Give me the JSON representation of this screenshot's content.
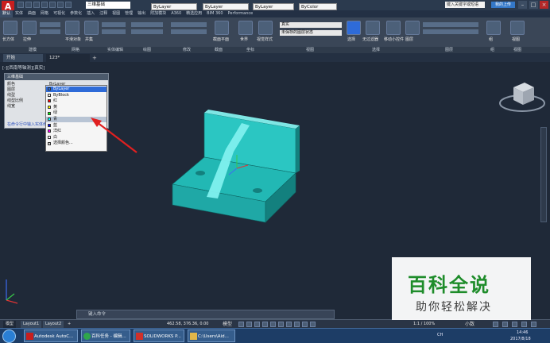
{
  "title_bar": {
    "app_logo": "A",
    "workspace": "三维基础",
    "color_combo": "ByLayer",
    "linetype_combo": "ByLayer",
    "lineweight_combo": "ByLayer",
    "plotstyle_combo": "ByColor",
    "search_placeholder": "键入关键字或短语",
    "signin": "我的上传",
    "window_controls": [
      "–",
      "□",
      "×"
    ]
  },
  "menu": {
    "items": [
      "默认",
      "实体",
      "曲面",
      "网格",
      "可视化",
      "参数化",
      "插入",
      "注释",
      "视图",
      "管理",
      "输出",
      "附加模块",
      "A360",
      "精选应用",
      "BIM 360",
      "Performance"
    ],
    "active_index": 0
  },
  "ribbon": {
    "buttons": [
      {
        "label": "长方体",
        "icon": "box-icon"
      },
      {
        "label": "拉伸",
        "icon": "extrude-icon"
      },
      {
        "label": "平滑对象",
        "icon": "smooth-icon"
      },
      {
        "label": "并集",
        "icon": "union-icon"
      },
      {
        "label": "视觉样式",
        "icon": "visual-style-icon"
      },
      {
        "label": "截面平面",
        "icon": "section-plane-icon"
      },
      {
        "label": "世界",
        "icon": "ucs-icon"
      },
      {
        "label": "图层",
        "icon": "layers-icon"
      },
      {
        "label": "选择",
        "icon": "cursor-icon"
      },
      {
        "label": "无过滤器",
        "icon": "filter-icon"
      },
      {
        "label": "移动小控件",
        "icon": "move-gizmo-icon"
      },
      {
        "label": "组",
        "icon": "group-icon"
      },
      {
        "label": "视图",
        "icon": "view-icon"
      }
    ],
    "visual_style_value": "真实",
    "layer_value": "未保存的图层状态",
    "panel_names": [
      "建模",
      "网格",
      "实体编辑",
      "绘图",
      "修改",
      "截面",
      "坐标",
      "视图",
      "选择",
      "图层",
      "组",
      "视图"
    ]
  },
  "doc_tabs": {
    "items": [
      "开始",
      "123*"
    ],
    "active_index": 1,
    "plus": "+"
  },
  "viewport_label": "[-][西南等轴测][真实]",
  "palette": {
    "title": "三维基础",
    "rows": [
      {
        "label": "颜色",
        "value": "ByLayer"
      },
      {
        "label": "图层",
        "value": ""
      },
      {
        "label": "线型",
        "value": ""
      },
      {
        "label": "线型比例",
        "value": ""
      },
      {
        "label": "线宽",
        "value": ""
      }
    ],
    "link": "在命令行中输入实体命令"
  },
  "color_dropdown": {
    "items": [
      {
        "label": "ByLayer",
        "swatch": "#ffffff"
      },
      {
        "label": "ByBlock",
        "swatch": "#ffffff"
      },
      {
        "label": "红",
        "swatch": "#ff0000"
      },
      {
        "label": "黄",
        "swatch": "#ffff00"
      },
      {
        "label": "绿",
        "swatch": "#00ff00"
      },
      {
        "label": "青",
        "swatch": "#00ffff"
      },
      {
        "label": "蓝",
        "swatch": "#0000ff"
      },
      {
        "label": "洋红",
        "swatch": "#ff00ff"
      },
      {
        "label": "白",
        "swatch": "#ffffff"
      },
      {
        "label": "选择颜色...",
        "swatch": "#cccccc"
      }
    ],
    "selected_index": 0,
    "highlight_index": 5
  },
  "model_colors": {
    "face_light": "#2bc6c2",
    "face_mid": "#1fa8a6",
    "face_dark": "#13807e",
    "strip": "#7ff0ee",
    "background": "#1f2938"
  },
  "command_line": {
    "placeholder": "键入命令"
  },
  "layout_tabs": {
    "items": [
      "模型",
      "Layout1",
      "Layout2"
    ],
    "active_index": 0,
    "plus": "+"
  },
  "status_bar": {
    "coords": "462.58, 376.36, 0.00",
    "model_label": "模型",
    "scale": "1:1 / 100%",
    "unit": "小数"
  },
  "taskbar": {
    "tasks": [
      {
        "label": "Autodesk AutoC...",
        "icon": "autocad-icon",
        "color": "#c81e1e"
      },
      {
        "label": "百科任务 - 编辑...",
        "icon": "browser-icon",
        "color": "#2fa64b"
      },
      {
        "label": "SOLIDWORKS P...",
        "icon": "solidworks-icon",
        "color": "#d0302a"
      },
      {
        "label": "C:\\Users\\Aid...",
        "icon": "folder-icon",
        "color": "#e2b74a"
      }
    ],
    "tray": {
      "lang": "CH",
      "time": "14:46",
      "date": "2017/8/18"
    }
  },
  "watermark": {
    "title": "百科全说",
    "subtitle": "助你轻松解决"
  }
}
